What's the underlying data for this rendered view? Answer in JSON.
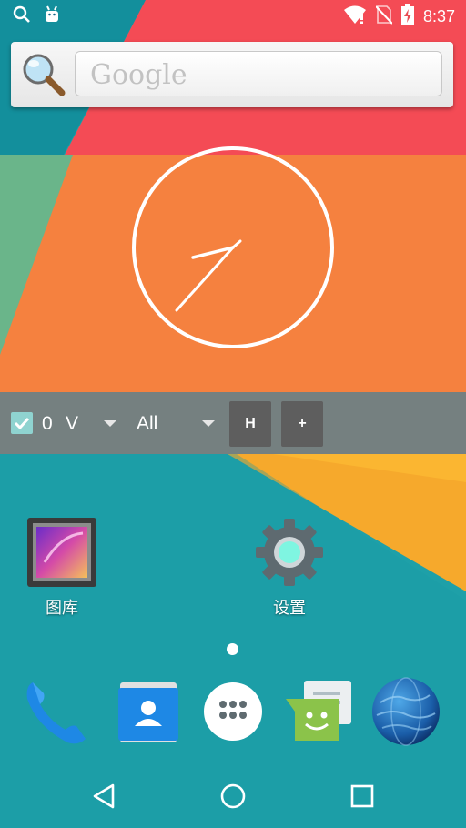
{
  "status_bar": {
    "time": "8:37",
    "icons": [
      "search-icon",
      "android-icon",
      "wifi-icon",
      "no-sim-icon",
      "battery-charging-icon"
    ]
  },
  "search_widget": {
    "placeholder": "Google",
    "icon": "magnifier-icon"
  },
  "clock_widget": {
    "type": "analog-clock",
    "time_shown": "8:37"
  },
  "toolbar": {
    "checkbox_checked": true,
    "count": "0",
    "mode": "V",
    "filter": "All",
    "h_button": "H",
    "plus_button": "+"
  },
  "apps": [
    {
      "label": "图库",
      "icon": "gallery-icon"
    },
    {
      "label": "设置",
      "icon": "settings-gear-icon"
    }
  ],
  "dock": [
    "phone-icon",
    "contacts-icon",
    "app-drawer-icon",
    "messaging-icon",
    "browser-globe-icon"
  ],
  "nav": [
    "back-icon",
    "home-icon",
    "recents-icon"
  ],
  "colors": {
    "wallpaper_teal": "#1ea0a8",
    "wallpaper_red": "#f44b55",
    "wallpaper_orange": "#f5813f",
    "wallpaper_yellow": "#f6a92c",
    "toolbar_gray": "#7d7d7d",
    "checkbox_teal": "#8fd3d0"
  }
}
